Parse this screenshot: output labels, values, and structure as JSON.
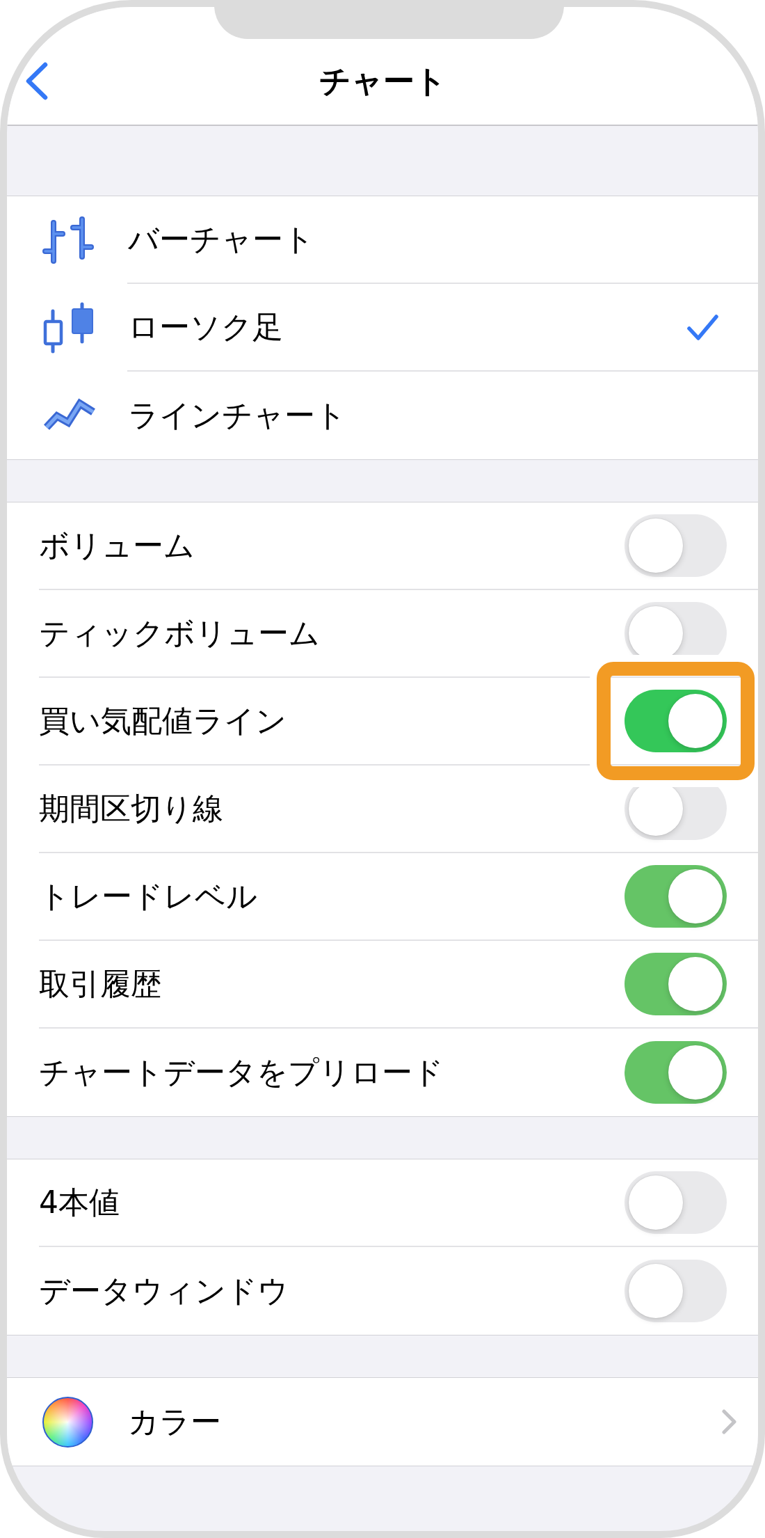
{
  "header": {
    "title": "チャート"
  },
  "chart_types": [
    {
      "kind": "bars",
      "label": "バーチャート",
      "selected": false
    },
    {
      "kind": "candles",
      "label": "ローソク足",
      "selected": true
    },
    {
      "kind": "line",
      "label": "ラインチャート",
      "selected": false
    }
  ],
  "display_options": [
    {
      "label": "ボリューム",
      "on": false,
      "highlighted": false
    },
    {
      "label": "ティックボリューム",
      "on": false,
      "highlighted": false
    },
    {
      "label": "買い気配値ライン",
      "on": true,
      "highlighted": true
    },
    {
      "label": "期間区切り線",
      "on": false,
      "highlighted": false
    },
    {
      "label": "トレードレベル",
      "on": true,
      "highlighted": false
    },
    {
      "label": "取引履歴",
      "on": true,
      "highlighted": false
    },
    {
      "label": "チャートデータをプリロード",
      "on": true,
      "highlighted": false
    }
  ],
  "data_options": [
    {
      "label": "4本値",
      "on": false
    },
    {
      "label": "データウィンドウ",
      "on": false
    }
  ],
  "color_row": {
    "label": "カラー"
  }
}
